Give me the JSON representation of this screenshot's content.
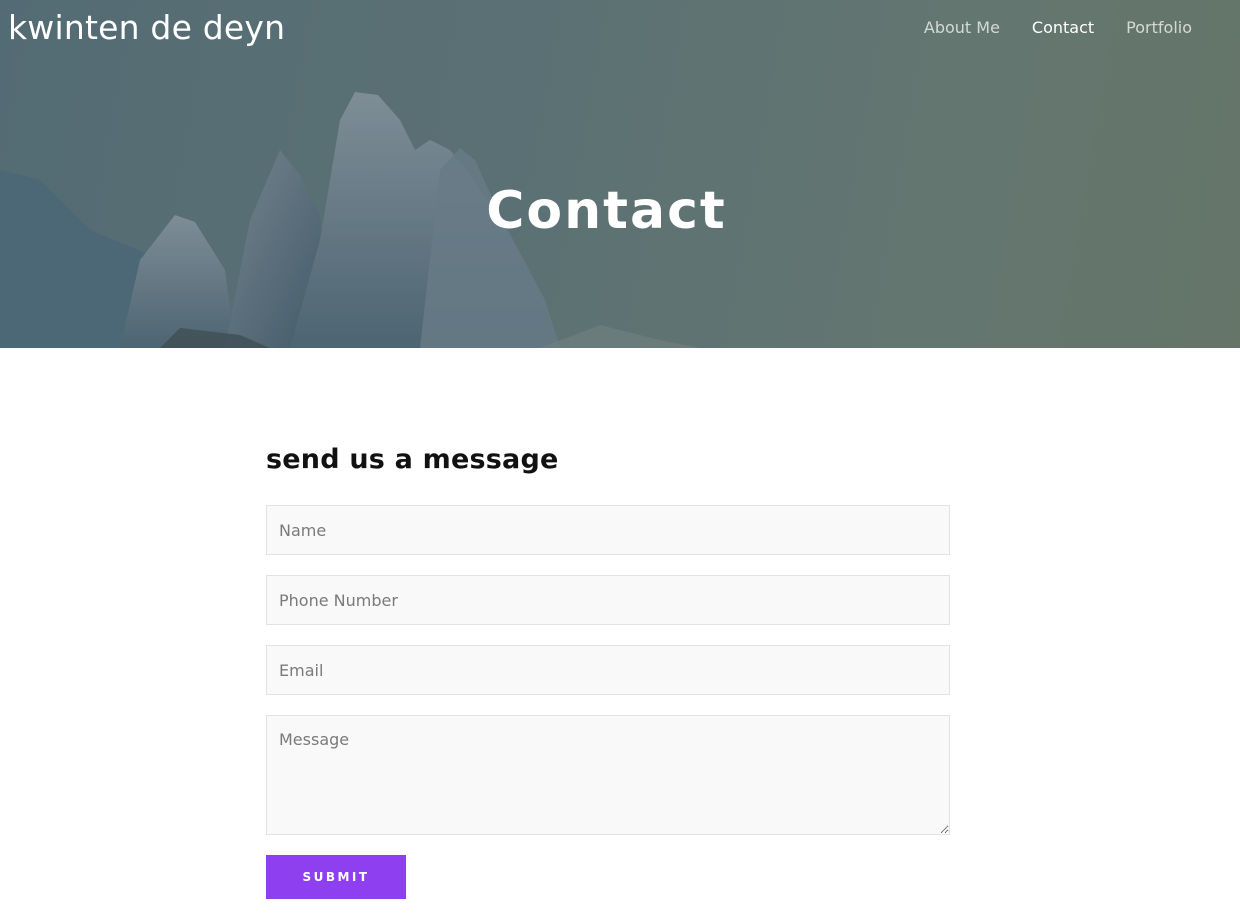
{
  "site": {
    "title": "kwinten de deyn"
  },
  "nav": {
    "items": [
      {
        "label": "About Me",
        "active": false
      },
      {
        "label": "Contact",
        "active": true
      },
      {
        "label": "Portfolio",
        "active": false
      }
    ]
  },
  "hero": {
    "title": "Contact"
  },
  "form": {
    "heading": "send us a message",
    "name_placeholder": "Name",
    "phone_placeholder": "Phone Number",
    "email_placeholder": "Email",
    "message_placeholder": "Message",
    "submit_label": "SUBMIT"
  },
  "colors": {
    "accent": "#8e3ff0",
    "field_background": "#f9f9f9",
    "field_border": "#e2e2e2"
  }
}
